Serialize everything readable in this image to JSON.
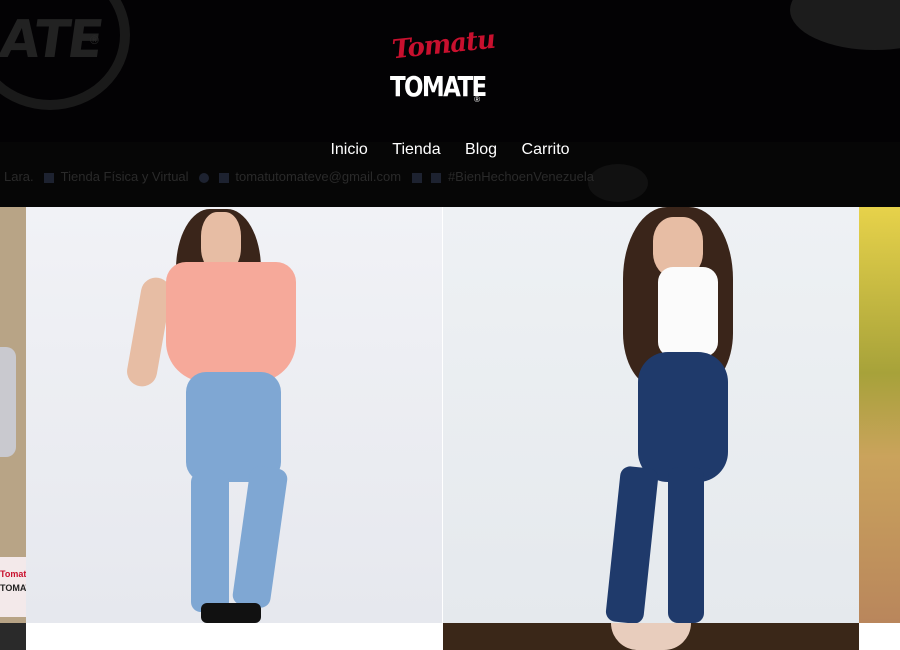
{
  "brand": {
    "logo_script": "Tomatu",
    "logo_block": "TOMATE",
    "logo_registered": "®",
    "accent_color": "#c8102e"
  },
  "nav": {
    "items": [
      "Inicio",
      "Tienda",
      "Blog",
      "Carrito"
    ]
  },
  "ticker": {
    "parts": [
      "Lara.",
      "Tienda Física y Virtual",
      "tomatutomateve@gmail.com",
      "#BienHechoenVenezuela"
    ]
  },
  "gallery": {
    "left_sticker_script": "Tomatu",
    "left_sticker_block": "TOMATE"
  }
}
